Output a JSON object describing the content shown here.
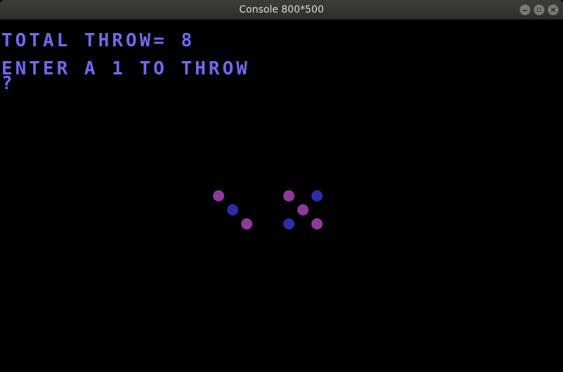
{
  "window": {
    "title": "Console 800*500"
  },
  "console": {
    "lines": [
      "TOTAL THROW= 8",
      "ENTER A 1 TO THROW",
      "?"
    ],
    "text_color": "#6e6af0",
    "background": "#000000"
  },
  "dice": {
    "pip_colors": {
      "magenta": "#8e3a9a",
      "blue": "#2d2ca8"
    },
    "die1": {
      "value": 3
    },
    "die2": {
      "value": 5
    },
    "total": 8
  }
}
